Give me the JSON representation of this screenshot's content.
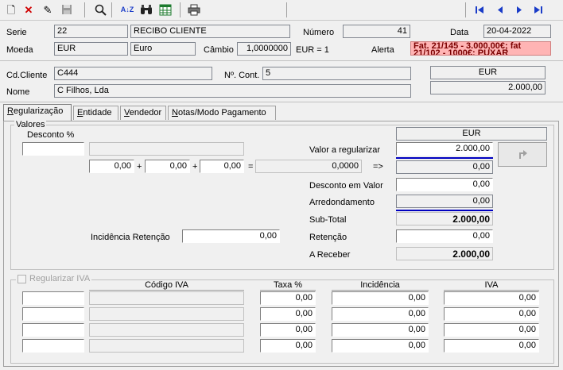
{
  "toolbar": {
    "icons": [
      "new-document-icon",
      "delete-icon",
      "edit-icon",
      "save-icon",
      "search-icon",
      "sort-az-icon",
      "binoculars-icon",
      "spreadsheet-icon",
      "print-icon",
      "first-record-icon",
      "previous-record-icon",
      "next-record-icon",
      "last-record-icon"
    ],
    "symbols": {
      "new": "🗋",
      "delete": "✕",
      "edit": "✎",
      "save": "▬",
      "search": "🔍",
      "sort": "A↓Z",
      "find": "◙◙",
      "sheet": "▦",
      "print": "⎙",
      "first": "⏮",
      "prev": "◀",
      "next": "▶",
      "last": "⏭"
    }
  },
  "header": {
    "serie_label": "Serie",
    "serie_value": "22",
    "serie_desc": "RECIBO CLIENTE",
    "numero_label": "Número",
    "numero_value": "41",
    "data_label": "Data",
    "data_value": "20-04-2022",
    "moeda_label": "Moeda",
    "moeda_value": "EUR",
    "moeda_desc": "Euro",
    "cambio_label": "Câmbio",
    "cambio_value": "1,0000000",
    "cambio_unit": "EUR = 1",
    "alerta_label": "Alerta",
    "alerta_value": "Fat. 21/145 - 3.000,00€; fat 21/102 - 1000€; PUXAR"
  },
  "client": {
    "cd_label": "Cd.Cliente",
    "cd_value": "C444",
    "ncont_label": "Nº. Cont.",
    "ncont_value": "5",
    "nome_label": "Nome",
    "nome_value": "C                          Filhos, Lda",
    "currency_header": "EUR",
    "total_value": "2.000,00"
  },
  "tabs": [
    {
      "label": "Regularização",
      "key": "R",
      "active": true
    },
    {
      "label": "Entidade",
      "key": "E",
      "active": false
    },
    {
      "label": "Vendedor",
      "key": "V",
      "active": false
    },
    {
      "label": "Notas/Modo Pagamento",
      "key": "N",
      "active": false
    }
  ],
  "valores": {
    "title": "Valores",
    "desconto_pct_label": "Desconto  %",
    "desconto_pct_value": "",
    "calc1": "0,00",
    "calc2": "0,00",
    "calc3": "0,00",
    "calc_result": "0,0000",
    "plus": "+",
    "equals": "=",
    "arrow": "=>",
    "currency_header": "EUR",
    "valor_regularizar_label": "Valor a regularizar",
    "valor_regularizar_value": "2.000,00",
    "arrow_result": "0,00",
    "desconto_valor_label": "Desconto em Valor",
    "desconto_valor_value": "0,00",
    "arredondamento_label": "Arredondamento",
    "arredondamento_value": "0,00",
    "subtotal_label": "Sub-Total",
    "subtotal_value": "2.000,00",
    "incidencia_retencao_label": "Incidência Retenção",
    "incidencia_retencao_value": "0,00",
    "retencao_label": "Retenção",
    "retencao_value": "0,00",
    "areceber_label": "A Receber",
    "areceber_value": "2.000,00"
  },
  "iva": {
    "checkbox_label": "Regularizar IVA",
    "col_codigo": "Código IVA",
    "col_taxa": "Taxa %",
    "col_incidencia": "Incidência",
    "col_iva": "IVA",
    "rows": [
      {
        "taxa": "0,00",
        "incidencia": "0,00",
        "iva": "0,00"
      },
      {
        "taxa": "0,00",
        "incidencia": "0,00",
        "iva": "0,00"
      },
      {
        "taxa": "0,00",
        "incidencia": "0,00",
        "iva": "0,00"
      },
      {
        "taxa": "0,00",
        "incidencia": "0,00",
        "iva": "0,00"
      }
    ]
  },
  "colors": {
    "alert_bg": "#ffb4b4",
    "accent_line": "#0000c0",
    "nav_blue": "#1a3cc8"
  }
}
